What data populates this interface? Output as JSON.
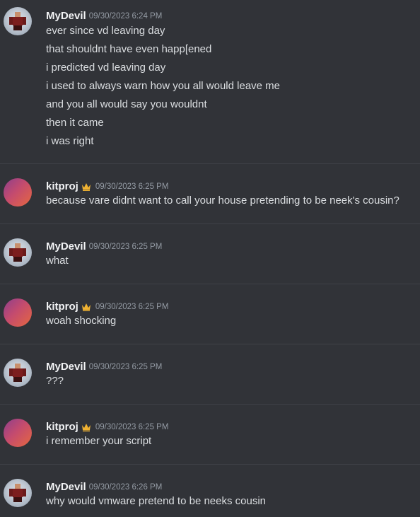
{
  "messages": [
    {
      "author": "MyDevil",
      "timestamp": "09/30/2023 6:24 PM",
      "avatar": "roblox-avatar",
      "lines": [
        "ever since vd leaving day",
        "that shouldnt have even happ[ened",
        "i predicted vd leaving day",
        "i used to always warn how you all would leave me",
        "and you all would say you wouldnt",
        "then it came",
        "i was right"
      ]
    },
    {
      "author": "kitproj",
      "timestamp": "09/30/2023 6:25 PM",
      "avatar": "gradient-avatar",
      "lines": [
        "because vare didnt want to call your house pretending to be neek's cousin?"
      ]
    },
    {
      "author": "MyDevil",
      "timestamp": "09/30/2023 6:25 PM",
      "avatar": "roblox-avatar",
      "lines": [
        "what"
      ]
    },
    {
      "author": "kitproj",
      "timestamp": "09/30/2023 6:25 PM",
      "avatar": "gradient-avatar",
      "lines": [
        "woah shocking"
      ]
    },
    {
      "author": "MyDevil",
      "timestamp": "09/30/2023 6:25 PM",
      "avatar": "roblox-avatar",
      "lines": [
        "???"
      ]
    },
    {
      "author": "kitproj",
      "timestamp": "09/30/2023 6:25 PM",
      "avatar": "gradient-avatar",
      "lines": [
        "i remember your script"
      ]
    },
    {
      "author": "MyDevil",
      "timestamp": "09/30/2023 6:26 PM",
      "avatar": "roblox-avatar",
      "lines": [
        "why would vmware pretend to be neeks cousin"
      ]
    }
  ],
  "badges": {
    "kitproj": "crown-icon"
  },
  "colors": {
    "background": "#313338",
    "username": "#f2f3f5",
    "text": "#dbdee1",
    "timestamp": "#949ba4",
    "divider": "#3f4147",
    "crown": "#f0b232"
  }
}
